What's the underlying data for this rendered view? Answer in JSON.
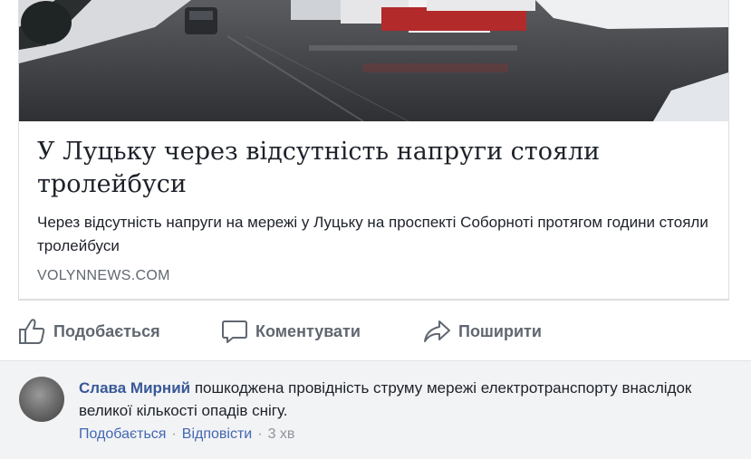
{
  "post": {
    "link_card": {
      "title": "У Луцьку через відсутність напруги стояли тролейбуси",
      "description": "Через відсутність напруги на мережі у Луцьку на проспекті Соборноті протягом години стояли тролейбуси",
      "domain": "VOLYNNEWS.COM"
    },
    "actions": {
      "like_label": "Подобається",
      "comment_label": "Коментувати",
      "share_label": "Поширити"
    }
  },
  "comment": {
    "author": "Слава Мирний",
    "text": "пошкоджена провідність струму мережі електротранспорту внаслідок великої кількості опадів снігу.",
    "like_label": "Подобається",
    "reply_label": "Відповісти",
    "separator": "·",
    "time": "3 хв"
  },
  "icons": {
    "like": "thumbs-up-icon",
    "comment": "speech-bubble-icon",
    "share": "share-arrow-icon"
  },
  "colors": {
    "link_blue": "#385898",
    "meta_blue": "#4267b2",
    "action_gray": "#606770",
    "comment_bg": "#f2f3f5"
  }
}
